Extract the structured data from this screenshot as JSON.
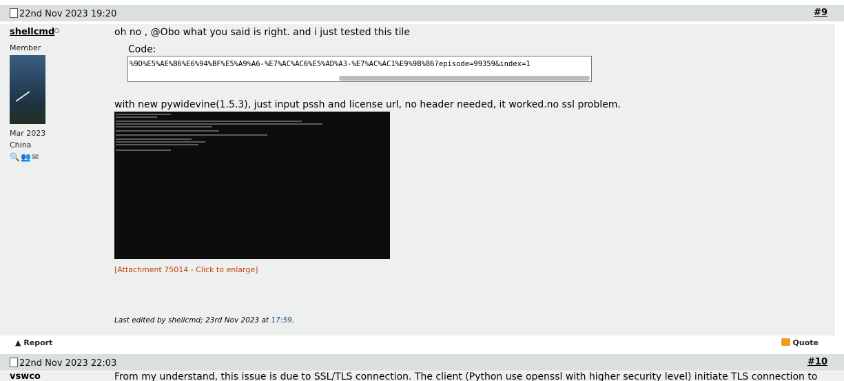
{
  "post9": {
    "date": "22nd Nov 2023 19:20",
    "number": "#9",
    "user": {
      "name": "shellcmd",
      "role": "Member",
      "joined": "Mar 2023",
      "location": "China",
      "action_icons": [
        "search-icon",
        "profile-icon",
        "mail-icon"
      ]
    },
    "line1": "oh no , @Obo what you said is right. and i just tested this tile",
    "code_label": "Code:",
    "code_text": "%9D%E5%AE%B6%E6%94%BF%E5%A9%A6-%E7%AC%AC6%E5%AD%A3-%E7%AC%AC1%E9%9B%86?episode=99359&index=1",
    "line2": "with new pywidevine(1.5.3), just input pssh and license url, no header needed, it worked.no ssl problem.",
    "attachment_link": "[Attachment 75014 - Click to enlarge]",
    "edited_prefix": "Last edited by shellcmd; 23rd Nov 2023 at ",
    "edited_time": "17:59",
    "edited_suffix": ".",
    "report_label": "Report",
    "quote_label": "Quote"
  },
  "post10": {
    "date": "22nd Nov 2023 22:03",
    "number": "#10",
    "user_name": "vswco",
    "line1": "From my understand, this issue is due to SSL/TLS connection. The client (Python use openssl with higher security level) initiate TLS connection to"
  }
}
